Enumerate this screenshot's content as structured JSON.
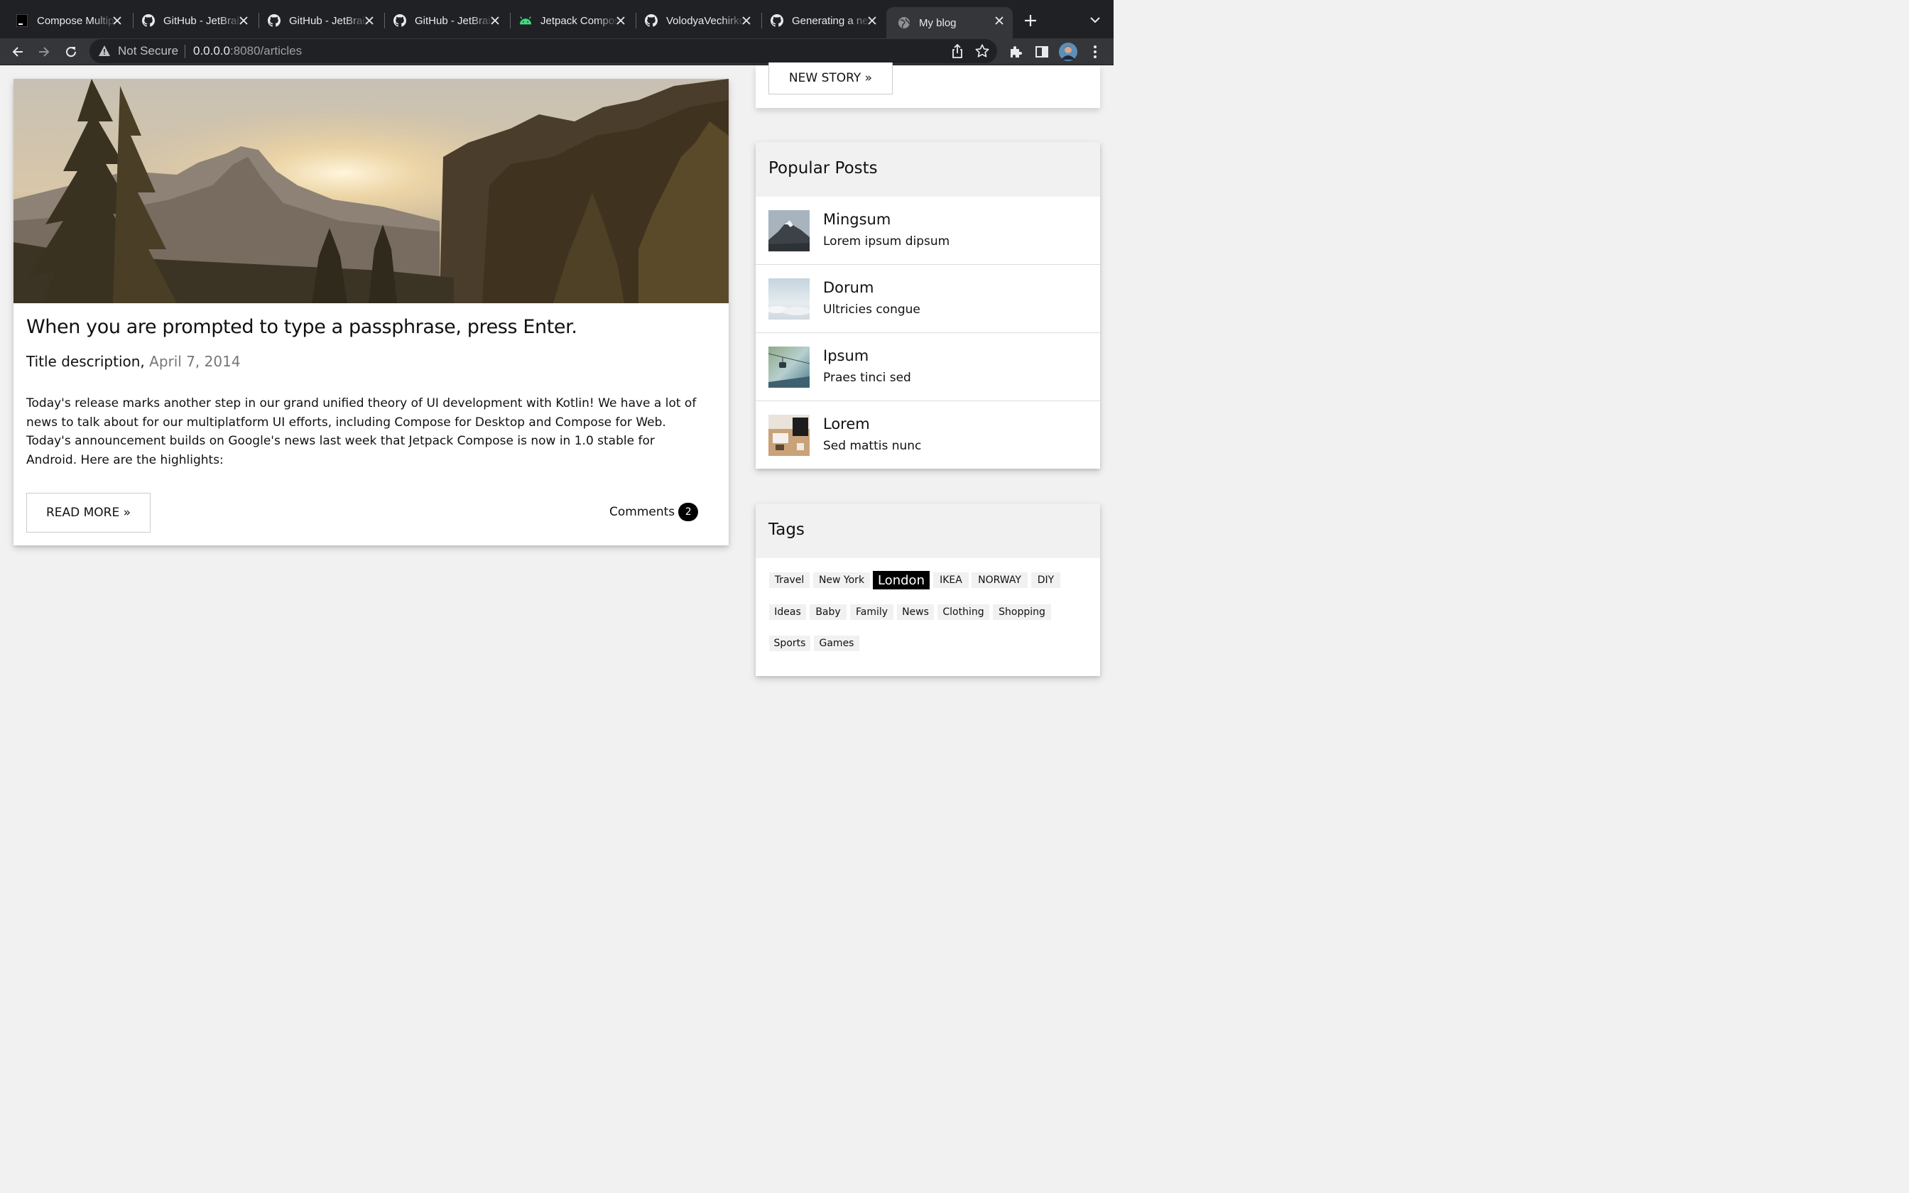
{
  "browser": {
    "tabs": [
      {
        "title": "Compose Multiplatform",
        "icon": "terminal-icon",
        "active": false
      },
      {
        "title": "GitHub - JetBrains",
        "icon": "github-icon",
        "active": false
      },
      {
        "title": "GitHub - JetBrains",
        "icon": "github-icon",
        "active": false
      },
      {
        "title": "GitHub - JetBrains",
        "icon": "github-icon",
        "active": false
      },
      {
        "title": "Jetpack Compose",
        "icon": "android-icon",
        "active": false
      },
      {
        "title": "VolodyaVechirko",
        "icon": "github-icon",
        "active": false
      },
      {
        "title": "Generating a new SSH key",
        "icon": "github-icon",
        "active": false
      },
      {
        "title": "My blog",
        "icon": "globe-icon",
        "active": true
      }
    ],
    "address": {
      "security_label": "Not Secure",
      "host": "0.0.0.0",
      "path": ":8080/articles"
    },
    "colors": {
      "tabbar": "#202124",
      "toolbar": "#35363a",
      "accent": "#000000"
    }
  },
  "sidebar_top": {
    "new_story_label": "NEW STORY »"
  },
  "article": {
    "title": "When you are prompted to type a passphrase, press Enter.",
    "subtitle": "Title description,",
    "date": "April 7, 2014",
    "body": "Today's release marks another step in our grand unified theory of UI development with Kotlin! We have a lot of news to talk about for our multiplatform UI efforts, including Compose for Desktop and Compose for Web. Today's announcement builds on Google's news last week that Jetpack Compose is now in 1.0 stable for Android. Here are the highlights:",
    "read_more_label": "READ MORE »",
    "comments_label": "Comments",
    "comments_count": "2",
    "image": "mountain-sunrise-forest"
  },
  "popular": {
    "heading": "Popular Posts",
    "posts": [
      {
        "title": "Mingsum",
        "subtitle": "Lorem ipsum dipsum",
        "image": "snowy-mountain"
      },
      {
        "title": "Dorum",
        "subtitle": "Ultricies congue",
        "image": "clouds-sky"
      },
      {
        "title": "Ipsum",
        "subtitle": "Praes tinci sed",
        "image": "cable-car"
      },
      {
        "title": "Lorem",
        "subtitle": "Sed mattis nunc",
        "image": "desk-workspace"
      }
    ]
  },
  "tags": {
    "heading": "Tags",
    "items": [
      {
        "label": "Travel",
        "active": false
      },
      {
        "label": "New York",
        "active": false
      },
      {
        "label": "London",
        "active": true
      },
      {
        "label": "IKEA",
        "active": false
      },
      {
        "label": "NORWAY",
        "active": false
      },
      {
        "label": "DIY",
        "active": false
      },
      {
        "label": "Ideas",
        "active": false
      },
      {
        "label": "Baby",
        "active": false
      },
      {
        "label": "Family",
        "active": false
      },
      {
        "label": "News",
        "active": false
      },
      {
        "label": "Clothing",
        "active": false
      },
      {
        "label": "Shopping",
        "active": false
      },
      {
        "label": "Sports",
        "active": false
      },
      {
        "label": "Games",
        "active": false
      }
    ]
  }
}
